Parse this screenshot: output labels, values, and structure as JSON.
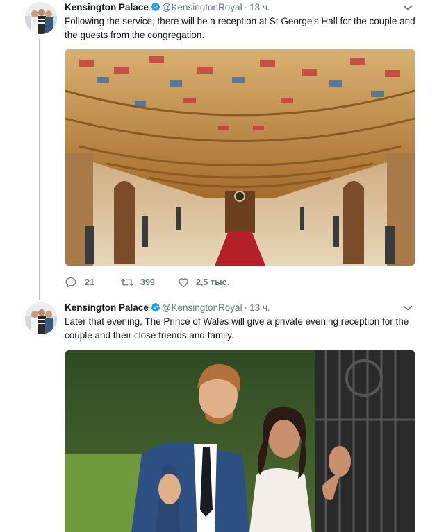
{
  "tweets": [
    {
      "display_name": "Kensington Palace",
      "handle": "@KensingtonRoyal",
      "separator": "·",
      "time": "13 ч.",
      "text": "Following the service, there will be a reception at St George's Hall for the couple and the guests from the congregation.",
      "media": {
        "icon": "hall-photo"
      },
      "actions": {
        "replies": "21",
        "retweets": "399",
        "likes": "2,5 тыс."
      }
    },
    {
      "display_name": "Kensington Palace",
      "handle": "@KensingtonRoyal",
      "separator": "·",
      "time": "13 ч.",
      "text": "Later that evening, The Prince of Wales will give a private evening reception for the couple and their close friends and family.",
      "media": {
        "icon": "couple-photo"
      }
    }
  ],
  "colors": {
    "thread_line": "#c4b5e4",
    "verified": "#1da1f2",
    "secondary_text": "#657786"
  },
  "icons": [
    "verified-badge-icon",
    "chevron-down-icon",
    "reply-icon",
    "retweet-icon",
    "like-icon"
  ]
}
